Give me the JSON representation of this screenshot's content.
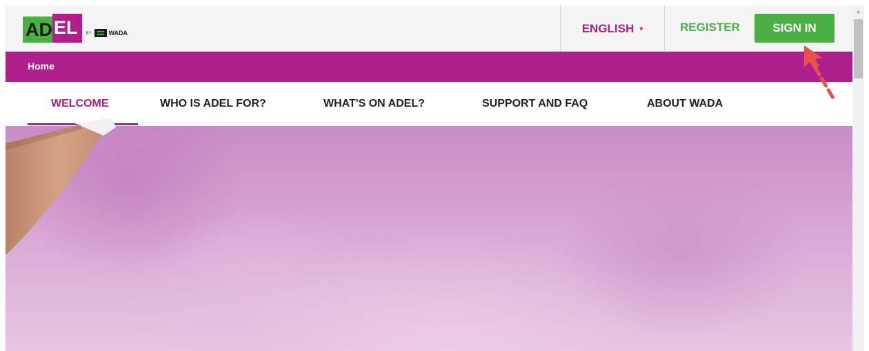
{
  "header": {
    "logo": {
      "part1": "AD",
      "part2": "EL",
      "by": "BY",
      "org": "WADA"
    },
    "language": {
      "label": "ENGLISH",
      "caret": "▾"
    },
    "register_label": "REGISTER",
    "signin_label": "SIGN IN"
  },
  "breadcrumb": {
    "home": "Home"
  },
  "nav": {
    "items": [
      {
        "label": "WELCOME",
        "active": true
      },
      {
        "label": "WHO IS ADEL FOR?"
      },
      {
        "label": "WHAT'S ON ADEL?"
      },
      {
        "label": "SUPPORT AND FAQ"
      },
      {
        "label": "ABOUT WADA"
      }
    ]
  },
  "colors": {
    "brand_magenta": "#b01e8c",
    "brand_green": "#4bb043",
    "annotation_arrow": "#e8524a"
  },
  "scrollbar": {
    "up_icon": "▲"
  }
}
